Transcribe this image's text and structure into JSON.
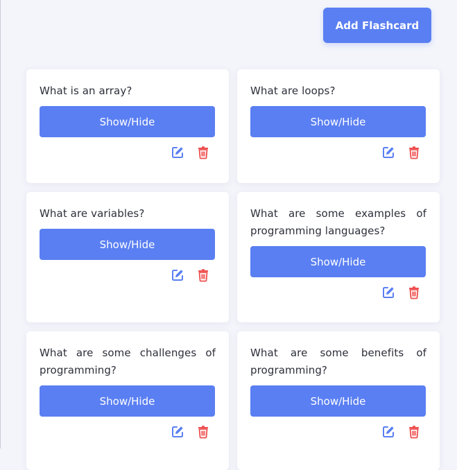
{
  "toolbar": {
    "add_label": "Add Flashcard"
  },
  "colors": {
    "accent": "#5a7ff2",
    "delete": "#ef4e4e",
    "page_bg": "#f4f5fb"
  },
  "cards": [
    {
      "question": "What is an array?",
      "toggle_label": "Show/Hide",
      "edit_icon": "edit-icon",
      "delete_icon": "trash-icon"
    },
    {
      "question": "What are loops?",
      "toggle_label": "Show/Hide",
      "edit_icon": "edit-icon",
      "delete_icon": "trash-icon"
    },
    {
      "question": "What are variables?",
      "toggle_label": "Show/Hide",
      "edit_icon": "edit-icon",
      "delete_icon": "trash-icon"
    },
    {
      "question": "What are some examples of programming languages?",
      "toggle_label": "Show/Hide",
      "edit_icon": "edit-icon",
      "delete_icon": "trash-icon"
    },
    {
      "question": "What are some challenges of programming?",
      "toggle_label": "Show/Hide",
      "edit_icon": "edit-icon",
      "delete_icon": "trash-icon"
    },
    {
      "question": "What are some benefits of programming?",
      "toggle_label": "Show/Hide",
      "edit_icon": "edit-icon",
      "delete_icon": "trash-icon"
    }
  ]
}
